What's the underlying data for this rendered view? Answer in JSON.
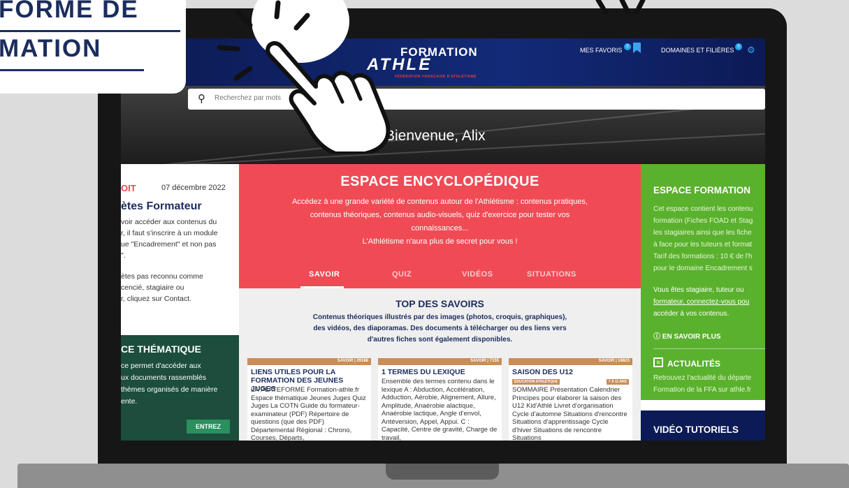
{
  "overlay": {
    "line1": "FORME DE",
    "line2": "MATION"
  },
  "header": {
    "logo_top": "FORMATION",
    "logo_main": "ATHLÉ",
    "logo_sub": "FÉDÉRATION FRANÇAISE D'ATHLÉTISME",
    "favorites_label": "MES FAVORIS",
    "favorites_count": "0",
    "domains_label": "DOMAINES ET FILIÈRES",
    "domains_count": "0"
  },
  "hero": {
    "search_placeholder": "Recherchez par mots",
    "welcome": "Bienvenue, Alix"
  },
  "left": {
    "tag": "OIT",
    "date": "07 décembre 2022",
    "title": "ètes Formateur",
    "p1": [
      "voir accéder aux contenus du",
      "r, il faut s'inscrire à un module",
      "ue \"Encadrement\" et non pas",
      "\"."
    ],
    "p2": [
      "ètes pas reconnu comme",
      "cencié, stagiaire ou",
      "r, cliquez sur Contact."
    ],
    "thematic_title": "CE THÉMATIQUE",
    "thematic_lines": [
      "ce permet d'accéder aux",
      "ux documents rassemblés",
      "thèmes organisés de manière",
      "ente."
    ],
    "enter_label": "ENTREZ"
  },
  "encyclo": {
    "title": "ESPACE ENCYCLOPÉDIQUE",
    "lines": [
      "Accédez à une grande variété de contenus autour de l'Athlétisme : contenus pratiques,",
      "contenus théoriques, contenus audio-visuels, quiz d'exercice pour tester vos",
      "connaissances...",
      "L'Athlétisme n'aura plus de secret pour vous !"
    ],
    "tabs": [
      "SAVOIR",
      "QUIZ",
      "VIDÉOS",
      "SITUATIONS"
    ]
  },
  "savoirs": {
    "title": "TOP DES SAVOIRS",
    "lines": [
      "Contenus théoriques illustrés par des images (photos, croquis, graphiques),",
      "des vidéos, des diaporamas. Des documents à télécharger ou des liens vers",
      "d'autres fiches sont également disponibles."
    ],
    "cards": [
      {
        "tag": "SAVOIR | 29188",
        "title": "LIENS UTILES POUR LA FORMATION DES JEUNES JUGES",
        "body": "LA PLATEFORME Formation-athle.fr Espace thématique Jeunes Juges Quiz Juges La COTN Guide du formateur-examinateur (PDF) Répertoire de questions (que des PDF) Départemental Régional : Chrono, Courses, Départs,"
      },
      {
        "tag": "SAVOIR | 7155",
        "title": "1 TERMES DU LEXIQUE",
        "body": "Ensemble des termes contenu dans le lexique A : Abduction, Accélération, Adduction, Aérobie, Alignement, Allure, Amplitude, Anaérobie alactique, Anaérobie lactique, Angle d'envol, Antéversion, Appel, Appui. C : Capacité, Centre de gravité, Charge de travail,"
      },
      {
        "tag": "SAVOIR | 18823",
        "title": "SAISON DES U12",
        "pill_left": "ÉDUCATION ATHLÉTIQUE",
        "pill_right": "7 À 11 ANS",
        "body": "SOMMAIRE Présentation Calendrier Principes pour élaborer la saison des U12 Kid'Athlé Livret d'organisation Cycle d'automne Situations d'rencontre Situations d'apprentissage Cycle d'hiver Situations de rencontre Situations"
      }
    ]
  },
  "right": {
    "formation_title": "ESPACE FORMATION",
    "formation_lines": [
      "Cet espace contient les contenu",
      "formation (Fiches FOAD et Stag",
      "les stagiaires ainsi que les fiche",
      "à face pour les tuteurs et format",
      "Tarif des formations : 10 € de l'h",
      "pour le domaine Encadrement s"
    ],
    "access_lines": [
      "Vous êtes stagiaire, tuteur ou",
      "formateur, connectez-vous pou",
      "accéder à vos contenus."
    ],
    "more_label": "EN SAVOIR PLUS",
    "actu_title": "ACTUALITÉS",
    "actu_lines": [
      "Retrouvez l'actualité du départe",
      "Formation de la FFA sur athle.fr"
    ],
    "video_title": "VIDÉO TUTORIELS"
  },
  "colors": {
    "navy": "#1b2d5e",
    "red": "#f04b55",
    "green": "#5ab12d",
    "dark_green": "#1c4d3d",
    "blue": "#3aa4ee"
  }
}
